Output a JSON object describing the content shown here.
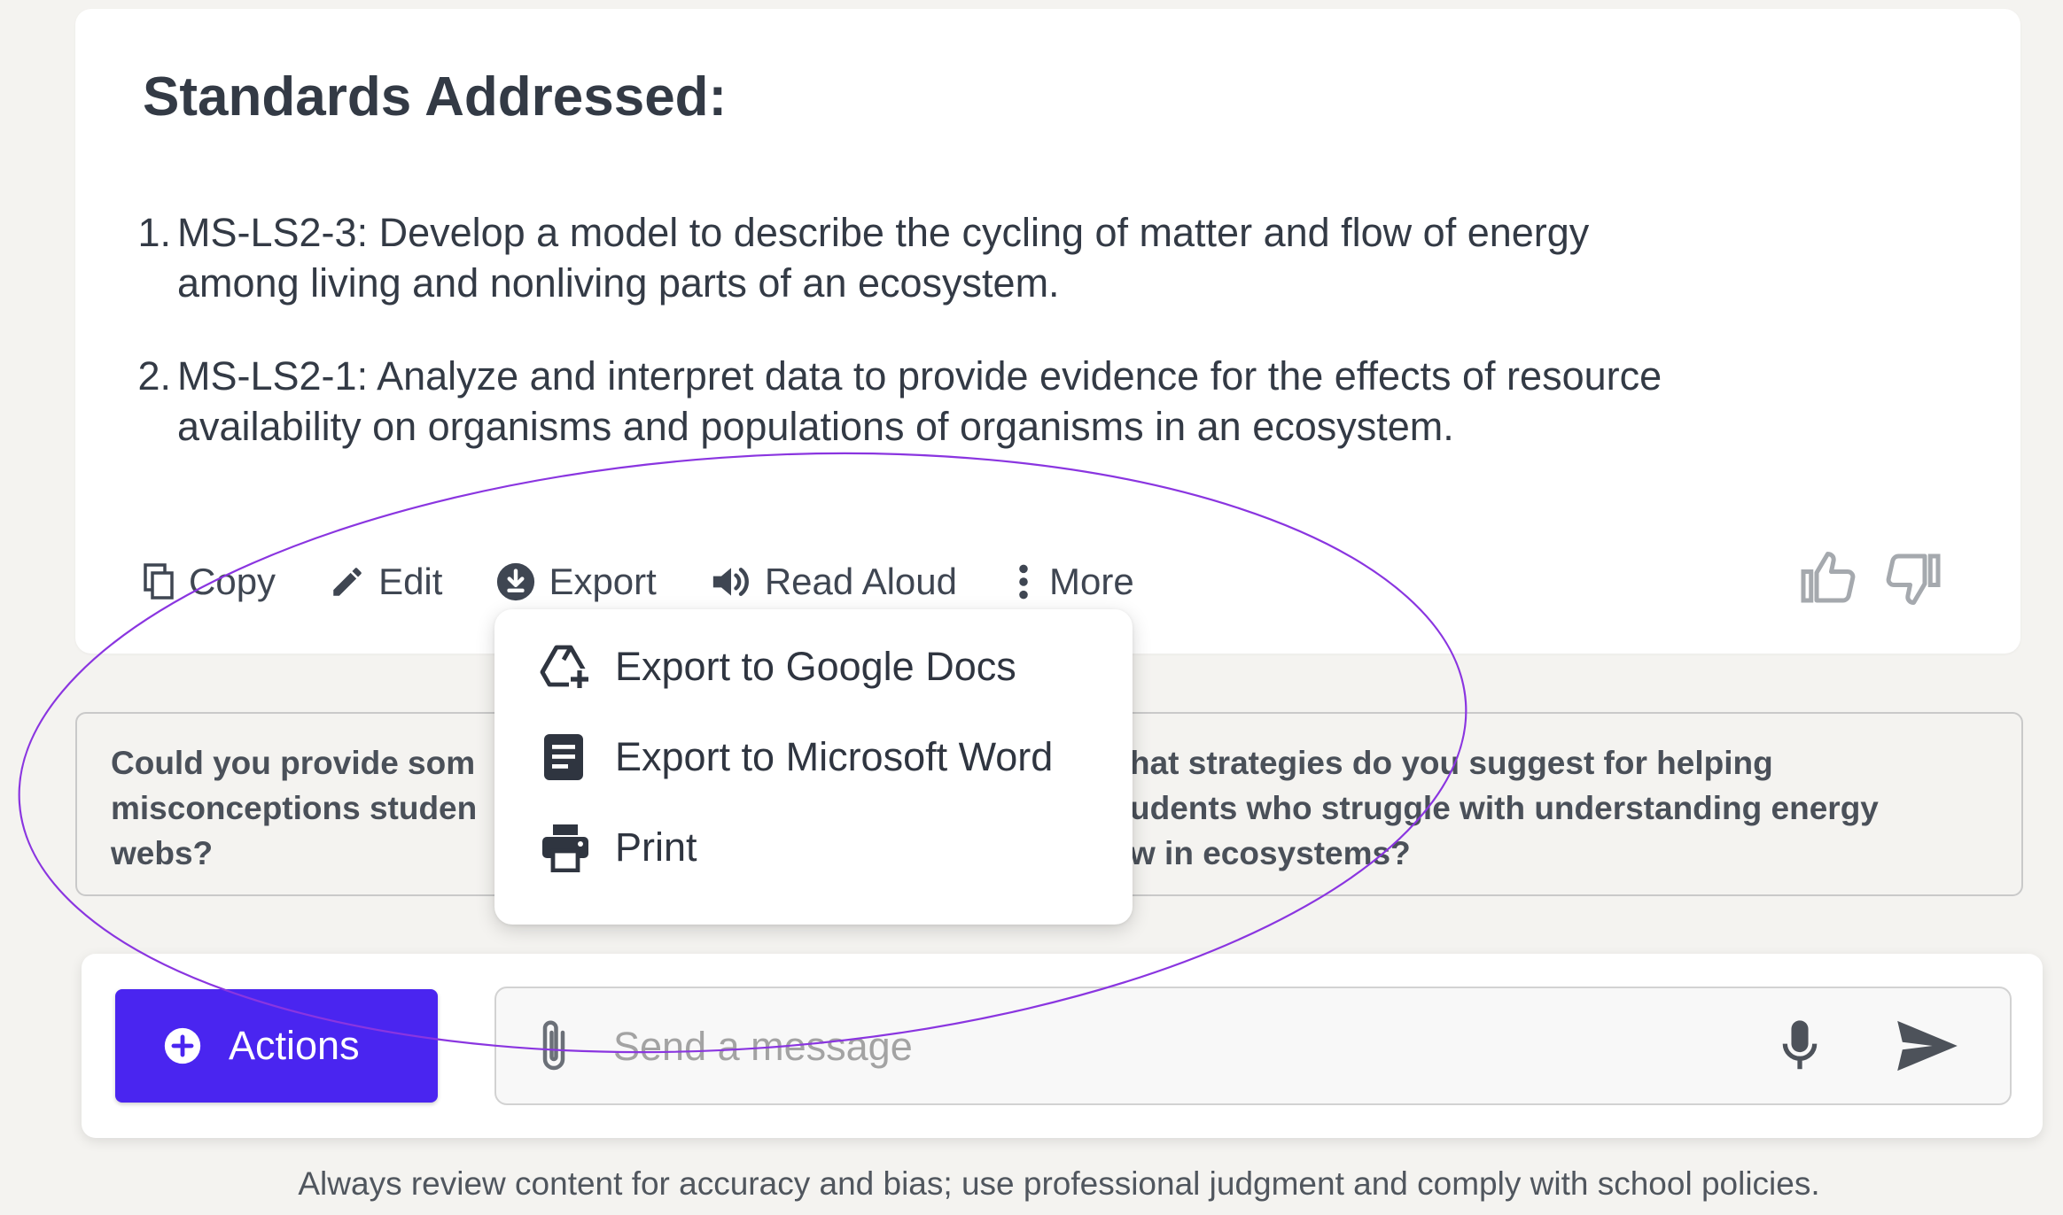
{
  "response": {
    "heading": "Standards Addressed:",
    "standards": [
      {
        "number": "1.",
        "line1": "MS-LS2-3: Develop a model to describe the cycling of matter and flow of energy",
        "line2": "among living and nonliving parts of an ecosystem."
      },
      {
        "number": "2.",
        "line1": "MS-LS2-1: Analyze and interpret data to provide evidence for the effects of resource",
        "line2": "availability on organisms and populations of organisms in an ecosystem."
      }
    ]
  },
  "toolbar": {
    "copy_label": "Copy",
    "edit_label": "Edit",
    "export_label": "Export",
    "read_aloud_label": "Read Aloud",
    "more_label": "More"
  },
  "export_menu": {
    "items": [
      {
        "label": "Export to Google Docs",
        "icon": "google-drive-add-icon"
      },
      {
        "label": "Export to Microsoft Word",
        "icon": "document-icon"
      },
      {
        "label": "Print",
        "icon": "printer-icon"
      }
    ]
  },
  "suggestions": {
    "left": [
      "Could you provide som",
      "misconceptions studen",
      "webs?"
    ],
    "right": [
      "hat strategies do you suggest for helping",
      "udents who struggle with understanding energy",
      "w in ecosystems?"
    ]
  },
  "composer": {
    "actions_label": "Actions",
    "message_placeholder": "Send a message"
  },
  "footer": {
    "disclaimer": "Always review content for accuracy and bias; use professional judgment and comply with school policies."
  },
  "colors": {
    "accent": "#4a25f0",
    "annotation": "#8a35e0",
    "text": "#333a45",
    "background": "#f4f3f0"
  }
}
